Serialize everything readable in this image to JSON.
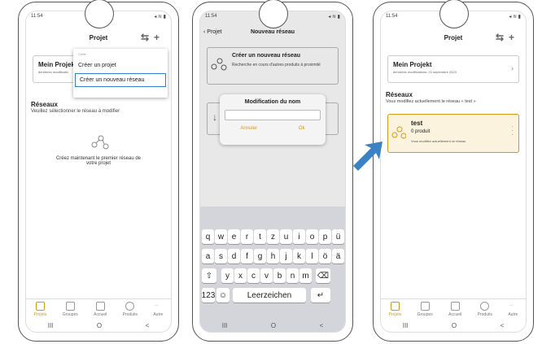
{
  "status": {
    "time": "11:54"
  },
  "phone1": {
    "title": "Projet",
    "project_name": "Mein Projek",
    "project_sub": "dernières modificatio",
    "menu_header": "Créer",
    "menu_item1": "Créer un projet",
    "menu_item2": "Créer un nouveau réseau",
    "networks_title": "Réseaux",
    "networks_sub": "Veuillez sélectionner le réseau à modifier",
    "empty_text": "Créez maintenant le premier réseau de votre projet"
  },
  "tabs": [
    "Projets",
    "Groupes",
    "Accueil",
    "Produits",
    "Autre"
  ],
  "nav": [
    "III",
    "O",
    "<"
  ],
  "phone2": {
    "back_label": "Projet",
    "title": "Nouveau réseau",
    "create_title": "Créer un nouveau réseau",
    "create_sub": "Recherche en cours d'autres produits à proximité",
    "dialog_title": "Modification du nom",
    "cancel": "Annuler",
    "ok": "Ok",
    "row1": [
      "q",
      "w",
      "e",
      "r",
      "t",
      "z",
      "u",
      "i",
      "o",
      "p",
      "ü"
    ],
    "row2": [
      "a",
      "s",
      "d",
      "f",
      "g",
      "h",
      "j",
      "k",
      "l",
      "ö",
      "ä"
    ],
    "row3": [
      "y",
      "x",
      "c",
      "v",
      "b",
      "n",
      "m"
    ],
    "key_123": "123",
    "space": "Leerzeichen"
  },
  "phone3": {
    "title": "Projet",
    "project_name": "Mein Projekt",
    "project_sub": "dernières modifications: 22 septembre 2023",
    "networks_title": "Réseaux",
    "networks_sub": "Vous modifiez actuellement le réseau « test »",
    "net_name": "test",
    "net_count": "0 produit",
    "net_note": "Vous modifiez actuellement ce réseau"
  },
  "colors": {
    "accent": "#d39a17",
    "blue": "#2f7fd0",
    "arrow": "#3a82c4"
  }
}
